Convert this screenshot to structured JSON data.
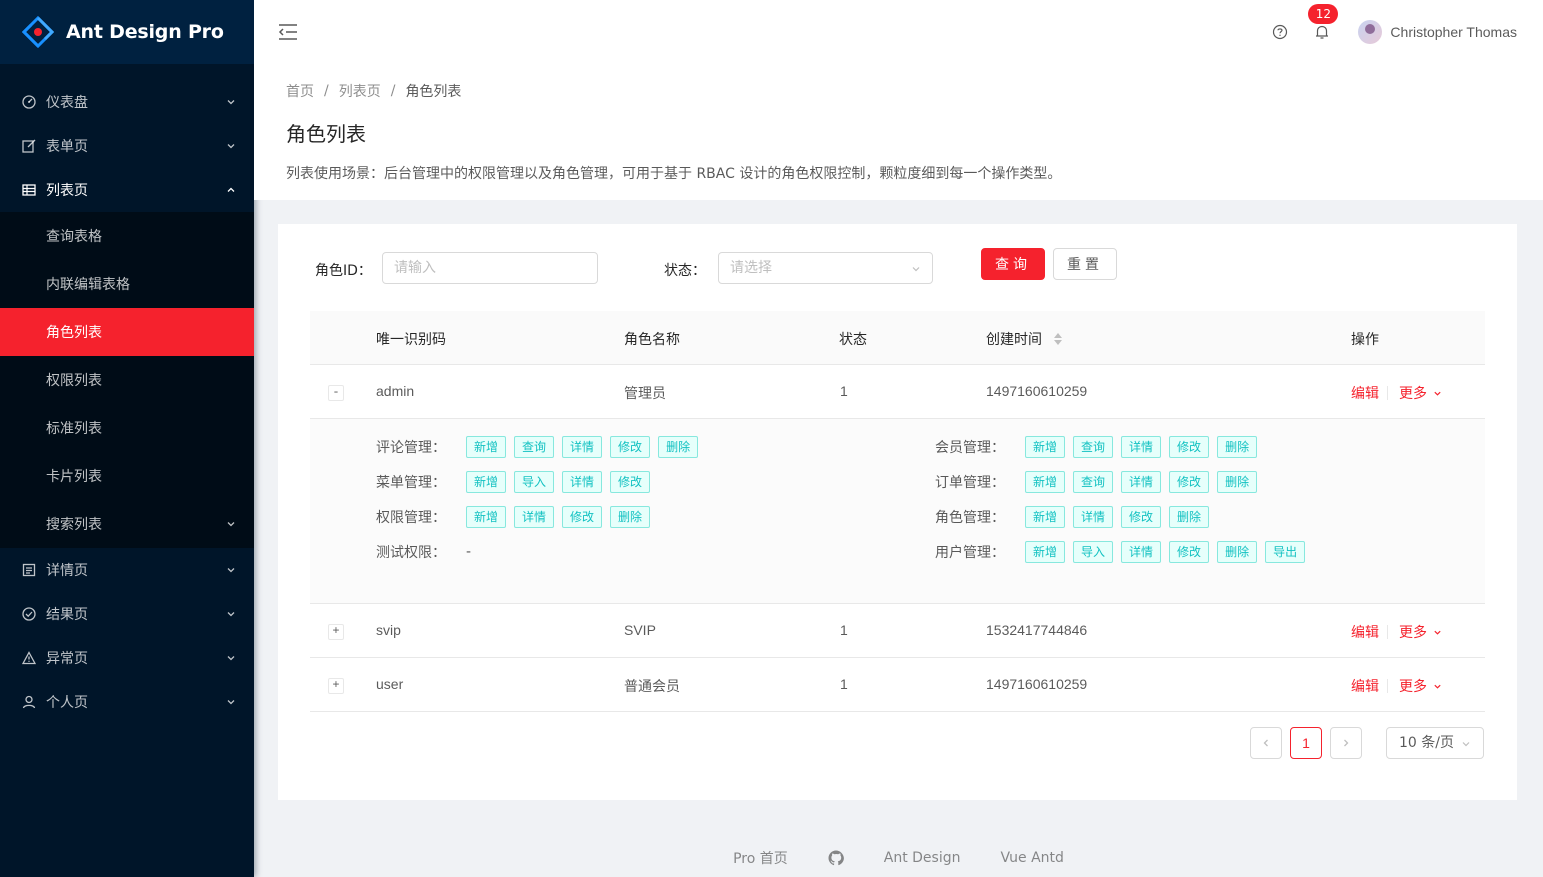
{
  "app": {
    "title": "Ant Design Pro"
  },
  "sidebar": {
    "items": [
      {
        "label": "仪表盘",
        "icon": "dashboard-icon",
        "expanded": false
      },
      {
        "label": "表单页",
        "icon": "form-icon",
        "expanded": false
      },
      {
        "label": "列表页",
        "icon": "table-icon",
        "expanded": true,
        "children": [
          {
            "label": "查询表格"
          },
          {
            "label": "内联编辑表格"
          },
          {
            "label": "角色列表",
            "active": true
          },
          {
            "label": "权限列表"
          },
          {
            "label": "标准列表"
          },
          {
            "label": "卡片列表"
          },
          {
            "label": "搜索列表",
            "has_children": true
          }
        ]
      },
      {
        "label": "详情页",
        "icon": "profile-icon",
        "expanded": false
      },
      {
        "label": "结果页",
        "icon": "check-circle-icon",
        "expanded": false
      },
      {
        "label": "异常页",
        "icon": "warning-icon",
        "expanded": false
      },
      {
        "label": "个人页",
        "icon": "user-icon",
        "expanded": false
      }
    ]
  },
  "header": {
    "notification_count": "12",
    "username": "Christopher Thomas"
  },
  "breadcrumb": [
    "首页",
    "列表页",
    "角色列表"
  ],
  "page": {
    "title": "角色列表",
    "description": "列表使用场景：后台管理中的权限管理以及角色管理，可用于基于 RBAC 设计的角色权限控制，颗粒度细到每一个操作类型。"
  },
  "search": {
    "role_id_label": "角色ID：",
    "role_id_placeholder": "请输入",
    "status_label": "状态：",
    "status_placeholder": "请选择",
    "query_label": "查询",
    "reset_label": "重置"
  },
  "table": {
    "columns": [
      "唯一识别码",
      "角色名称",
      "状态",
      "创建时间",
      "操作"
    ],
    "rows": [
      {
        "id": "admin",
        "name": "管理员",
        "status": "1",
        "created": "1497160610259",
        "expand": "-",
        "edit": "编辑",
        "more": "更多"
      },
      {
        "id": "svip",
        "name": "SVIP",
        "status": "1",
        "created": "1532417744846",
        "expand": "+",
        "edit": "编辑",
        "more": "更多"
      },
      {
        "id": "user",
        "name": "普通会员",
        "status": "1",
        "created": "1497160610259",
        "expand": "+",
        "edit": "编辑",
        "more": "更多"
      }
    ],
    "permissions": [
      {
        "label": "评论管理：",
        "tags": [
          "新增",
          "查询",
          "详情",
          "修改",
          "删除"
        ]
      },
      {
        "label": "会员管理：",
        "tags": [
          "新增",
          "查询",
          "详情",
          "修改",
          "删除"
        ]
      },
      {
        "label": "菜单管理：",
        "tags": [
          "新增",
          "导入",
          "详情",
          "修改"
        ]
      },
      {
        "label": "订单管理：",
        "tags": [
          "新增",
          "查询",
          "详情",
          "修改",
          "删除"
        ]
      },
      {
        "label": "权限管理：",
        "tags": [
          "新增",
          "详情",
          "修改",
          "删除"
        ]
      },
      {
        "label": "角色管理：",
        "tags": [
          "新增",
          "详情",
          "修改",
          "删除"
        ]
      },
      {
        "label": "测试权限：",
        "tags": [],
        "empty": "-"
      },
      {
        "label": "用户管理：",
        "tags": [
          "新增",
          "导入",
          "详情",
          "修改",
          "删除",
          "导出"
        ]
      }
    ]
  },
  "pagination": {
    "current": "1",
    "page_size": "10 条/页"
  },
  "footer": {
    "links": [
      "Pro 首页",
      "Ant Design",
      "Vue Antd"
    ]
  },
  "colors": {
    "primary": "#f5222d",
    "sidebar_bg": "#001529",
    "tag_cyan": "#13c2c2"
  }
}
